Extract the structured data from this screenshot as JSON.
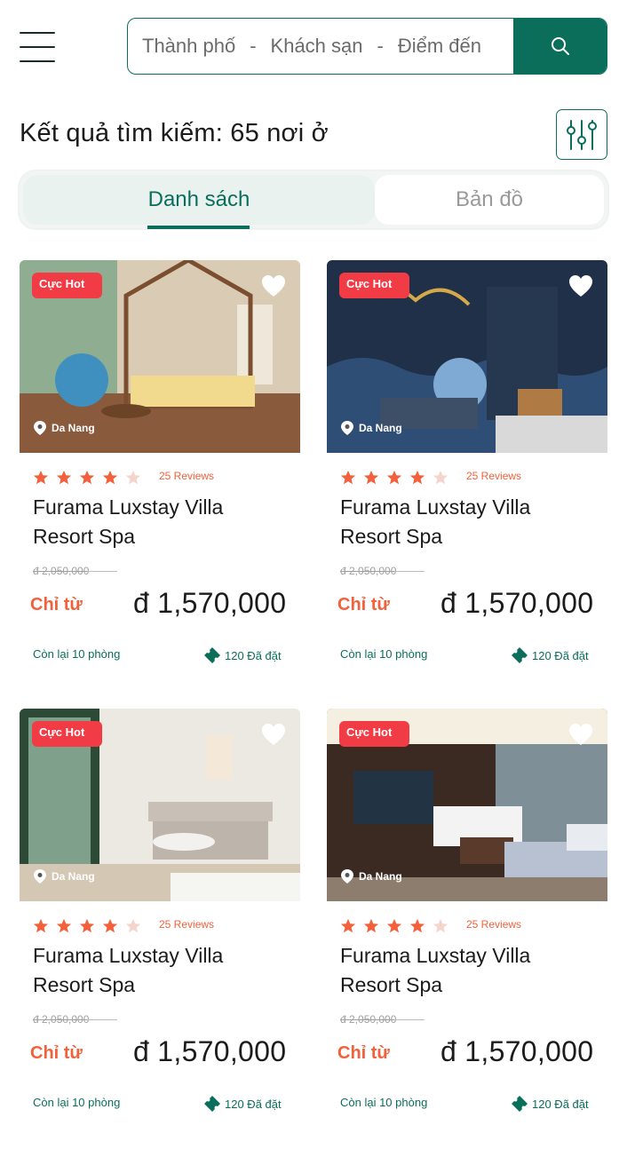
{
  "header": {
    "menu_icon": "hamburger-menu-icon",
    "search": {
      "city": "Thành phố",
      "separator": "-",
      "hotel": "Khách sạn",
      "destination": "Điểm đến",
      "button_icon": "search-icon"
    }
  },
  "results": {
    "title": "Kết quả tìm kiếm: 65 nơi ở",
    "filter_icon": "filter-sliders-icon"
  },
  "tabs": {
    "list": "Danh sách",
    "map": "Bản đồ",
    "active": "list"
  },
  "colors": {
    "brand": "#0a6e5a",
    "hot": "#f23c45",
    "accent": "#f2613b",
    "star_empty": "#f3d5cc"
  },
  "cards": [
    {
      "badge": "Cực Hot",
      "location": "Da Nang",
      "rating": 4,
      "reviews": "25 Reviews",
      "name": "Furama Luxstay Villa Resort Spa",
      "old_price": "đ 2,050,000",
      "from_label": "Chỉ từ",
      "price": "đ 1,570,000",
      "rooms_left": "Còn lại 10 phòng",
      "booked": "120 Đã đặt"
    },
    {
      "badge": "Cực Hot",
      "location": "Da Nang",
      "rating": 4,
      "reviews": "25 Reviews",
      "name": "Furama Luxstay Villa Resort Spa",
      "old_price": "đ 2,050,000",
      "from_label": "Chỉ từ",
      "price": "đ 1,570,000",
      "rooms_left": "Còn lại 10 phòng",
      "booked": "120 Đã đặt"
    },
    {
      "badge": "Cực Hot",
      "location": "Da Nang",
      "rating": 4,
      "reviews": "25 Reviews",
      "name": "Furama Luxstay Villa Resort Spa",
      "old_price": "đ 2,050,000",
      "from_label": "Chỉ từ",
      "price": "đ 1,570,000",
      "rooms_left": "Còn lại 10 phòng",
      "booked": "120 Đã đặt"
    },
    {
      "badge": "Cực Hot",
      "location": "Da Nang",
      "rating": 4,
      "reviews": "25 Reviews",
      "name": "Furama Luxstay Villa Resort Spa",
      "old_price": "đ 2,050,000",
      "from_label": "Chỉ từ",
      "price": "đ 1,570,000",
      "rooms_left": "Còn lại 10 phòng",
      "booked": "120 Đã đặt"
    }
  ]
}
